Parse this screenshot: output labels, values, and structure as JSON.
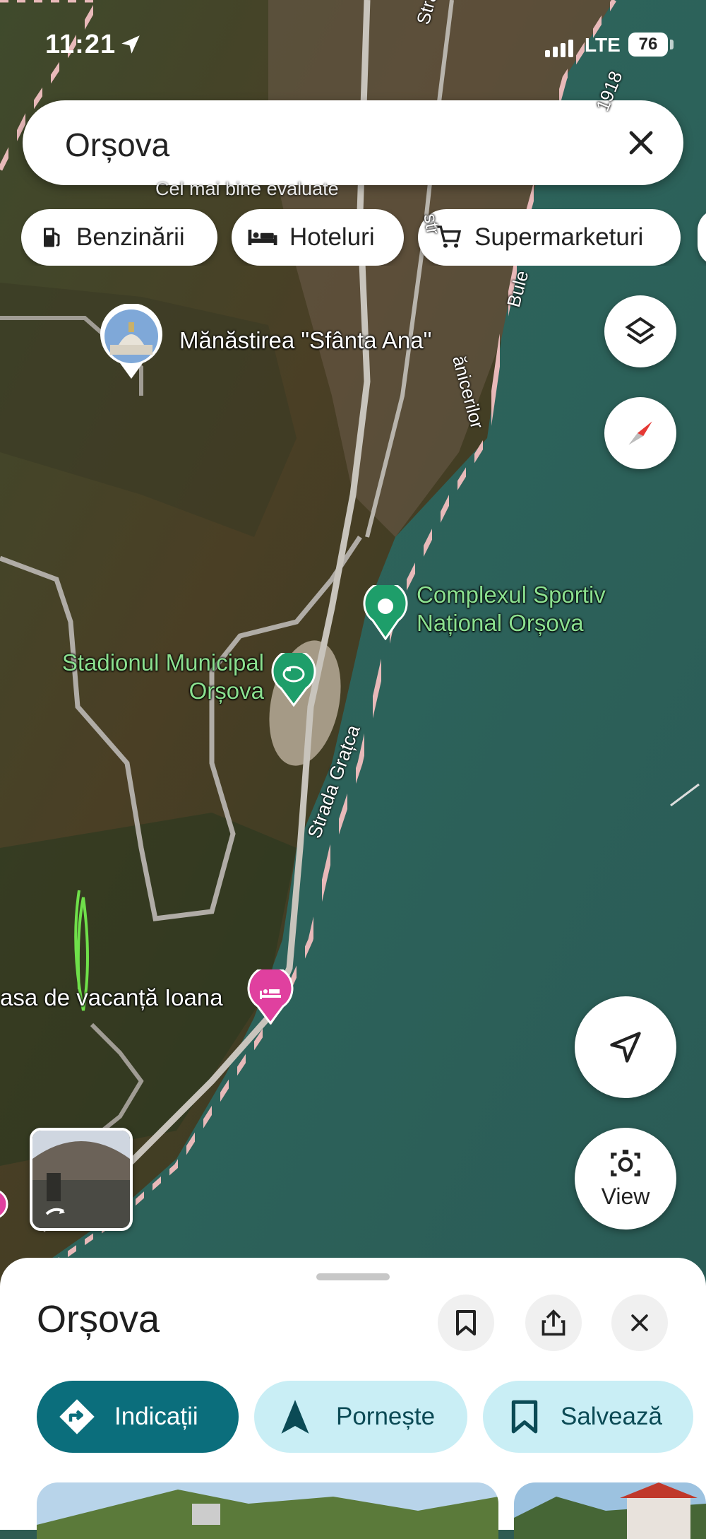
{
  "status_bar": {
    "time": "11:21",
    "network": "LTE",
    "battery": "76"
  },
  "search": {
    "query": "Orșova",
    "hint": "Cel mai bine evaluate"
  },
  "chips": [
    {
      "label": "Benzinării",
      "icon": "gas-station-icon"
    },
    {
      "label": "Hoteluri",
      "icon": "bed-icon"
    },
    {
      "label": "Supermarketuri",
      "icon": "shopping-cart-icon"
    }
  ],
  "map": {
    "places": {
      "monastery": "Mănăstirea \"Sfânta Ana\"",
      "sports_complex": "Complexul Sportiv Național Orșova",
      "stadium": "Stadionul Municipal Orșova",
      "holiday_house": "asa de vacanță Ioana"
    },
    "roads": {
      "strada_gratca": "Strada Grațca",
      "strada_top": "Strada",
      "strada_right": "Strada",
      "date_1918": "1918",
      "bulevard": "Bule",
      "ceferistilor": "ănicerilor",
      "str_a": "str"
    }
  },
  "map_controls": {
    "view_label": "View"
  },
  "sheet": {
    "title": "Orșova",
    "actions": {
      "directions": "Indicații",
      "start": "Pornește",
      "save": "Salvează"
    }
  },
  "colors": {
    "accent": "#0b6e7c",
    "accent_light": "#c9eef5",
    "poi_green": "#1e9e6a",
    "poi_pink": "#e0409f"
  }
}
